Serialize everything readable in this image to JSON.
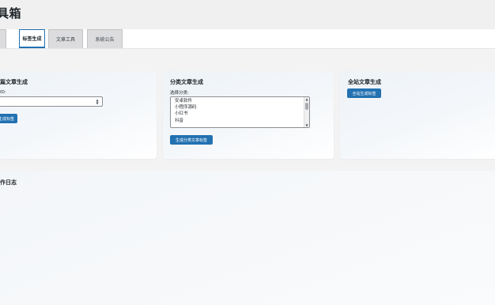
{
  "header": {
    "title": "工具箱",
    "title_visible": "具箱"
  },
  "tabs": [
    {
      "label": ""
    },
    {
      "label": "标签生成",
      "active": true
    },
    {
      "label": "文章工具"
    },
    {
      "label": "系统公告"
    }
  ],
  "cards": {
    "single": {
      "title_visible": "篇文章生成",
      "field_label_visible": "ID:",
      "input_value": "",
      "button_visible": "生成标签"
    },
    "category": {
      "title": "分类文章生成",
      "select_label": "选择分类:",
      "options": [
        "安卓软件",
        "小程序源码",
        "小红书",
        "抖音"
      ],
      "button": "生成分类文章标签"
    },
    "site": {
      "title": "全站文章生成",
      "button": "全站生成标签"
    }
  },
  "log": {
    "title_visible": "作日志"
  },
  "colors": {
    "primary": "#2271b1",
    "page_bg": "#f3f3f3"
  }
}
